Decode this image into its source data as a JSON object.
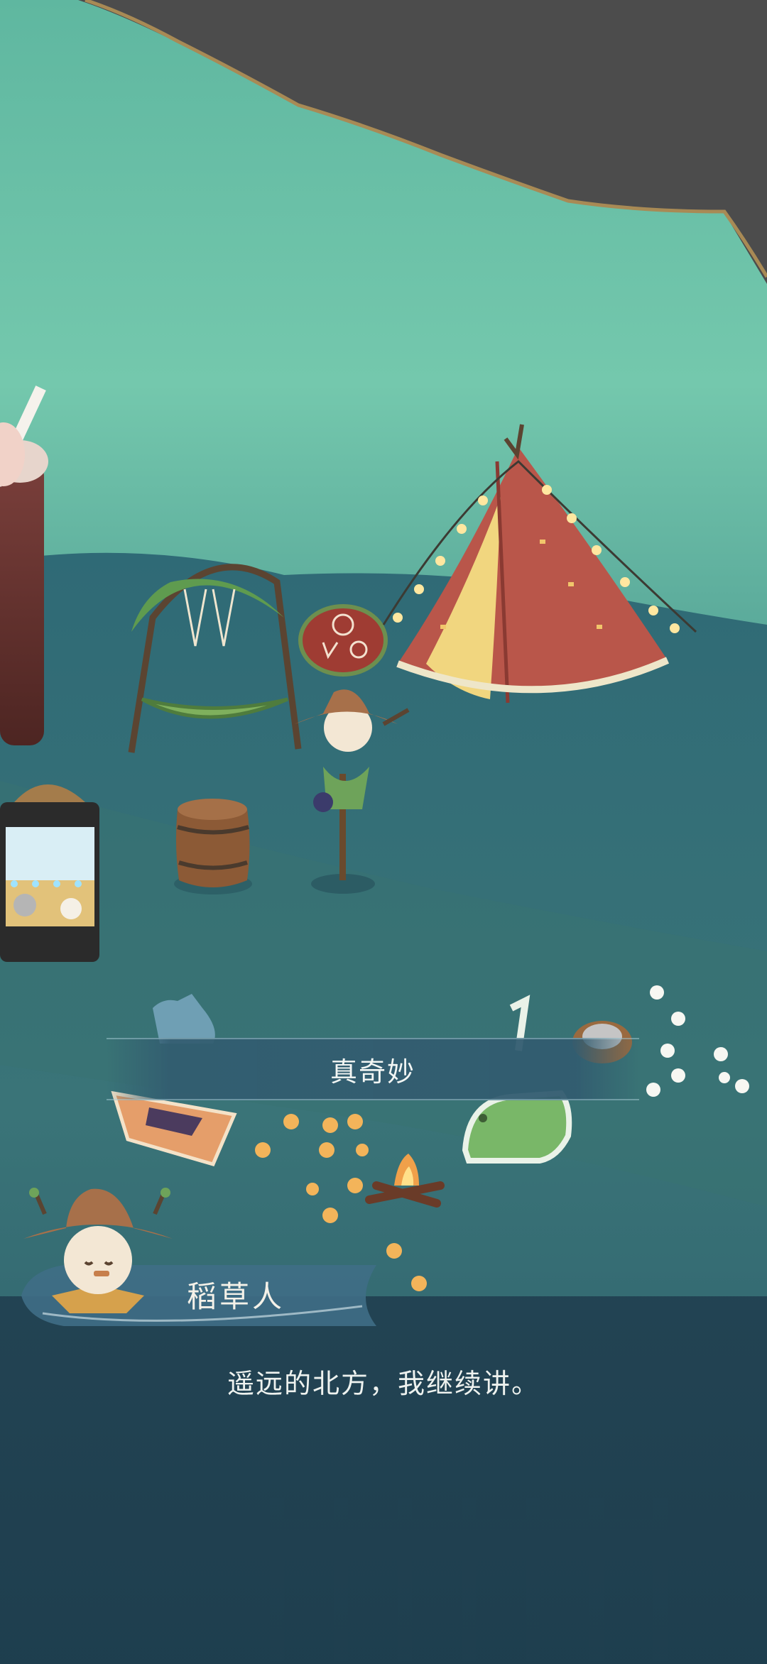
{
  "choice": {
    "label": "真奇妙"
  },
  "dialog": {
    "speaker": "稻草人",
    "text": "遥远的北方，我继续讲。"
  },
  "scene": {
    "description_icons": [
      "iced-drink-icon",
      "hammock-icon",
      "tent-icon",
      "scarecrow-icon",
      "barrel-icon",
      "gashapon-machine-icon",
      "campfire-icon",
      "frog-figure-icon",
      "flower-patch-icon",
      "sign-board-icon"
    ]
  },
  "colors": {
    "water": "#6cc3a8",
    "ground": "#2f6170",
    "tent": "#b9564a",
    "panel": "#223f50"
  }
}
